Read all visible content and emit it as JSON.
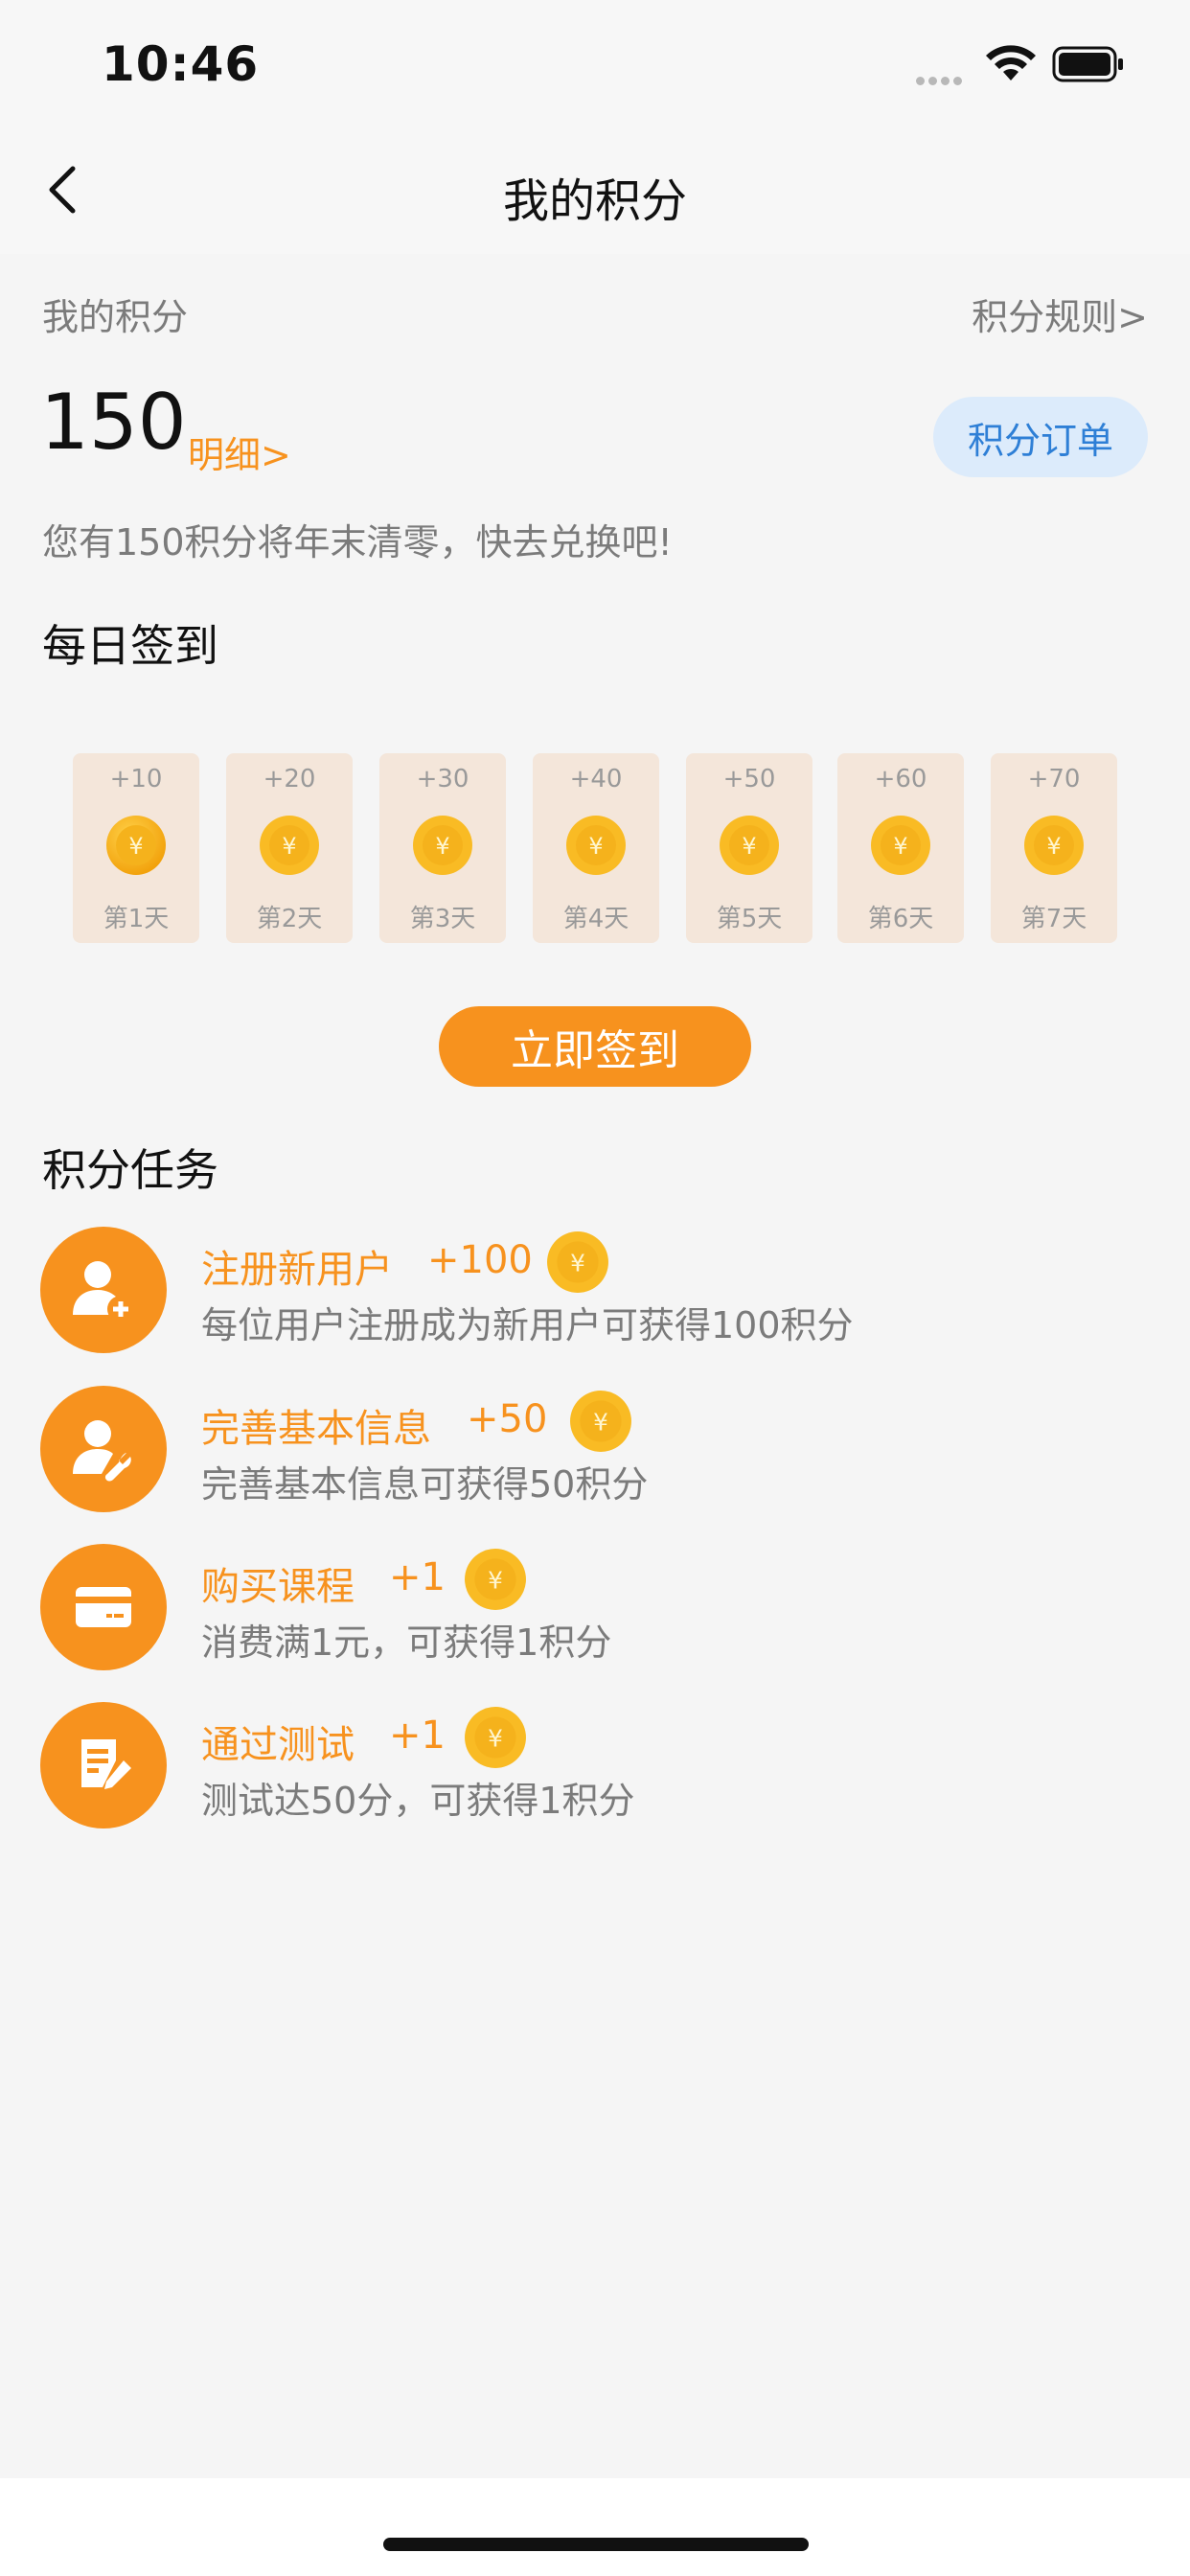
{
  "status_bar": {
    "time": "10:46",
    "icons": [
      "signal-icon",
      "wifi-icon",
      "battery-icon"
    ]
  },
  "nav": {
    "title": "我的积分",
    "back_icon": "chevron-left-icon"
  },
  "summary": {
    "label": "我的积分",
    "rules_link": "积分规则>",
    "points": "150",
    "detail_link": "明细>",
    "orders_button": "积分订单",
    "expire_note": "您有150积分将年末清零，快去兑换吧!"
  },
  "checkin": {
    "title": "每日签到",
    "days": [
      {
        "points": "+10",
        "label": "第1天"
      },
      {
        "points": "+20",
        "label": "第2天"
      },
      {
        "points": "+30",
        "label": "第3天"
      },
      {
        "points": "+40",
        "label": "第4天"
      },
      {
        "points": "+50",
        "label": "第5天"
      },
      {
        "points": "+60",
        "label": "第6天"
      },
      {
        "points": "+70",
        "label": "第7天"
      }
    ],
    "button": "立即签到"
  },
  "tasks": {
    "title": "积分任务",
    "items": [
      {
        "name": "注册新用户",
        "reward": "+100",
        "desc": "每位用户注册成为新用户可获得100积分",
        "icon": "user-add-icon"
      },
      {
        "name": "完善基本信息",
        "reward": "+50",
        "desc": "完善基本信息可获得50积分",
        "icon": "user-settings-icon"
      },
      {
        "name": "购买课程",
        "reward": "+1",
        "desc": "消费满1元，可获得1积分",
        "icon": "card-icon"
      },
      {
        "name": "通过测试",
        "reward": "+1",
        "desc": "测试达50分，可获得1积分",
        "icon": "test-edit-icon"
      }
    ]
  },
  "colors": {
    "accent": "#f7921e",
    "orders_bg": "#dcebfb",
    "orders_text": "#2e7fd6",
    "card_bg": "#f4e6da"
  }
}
